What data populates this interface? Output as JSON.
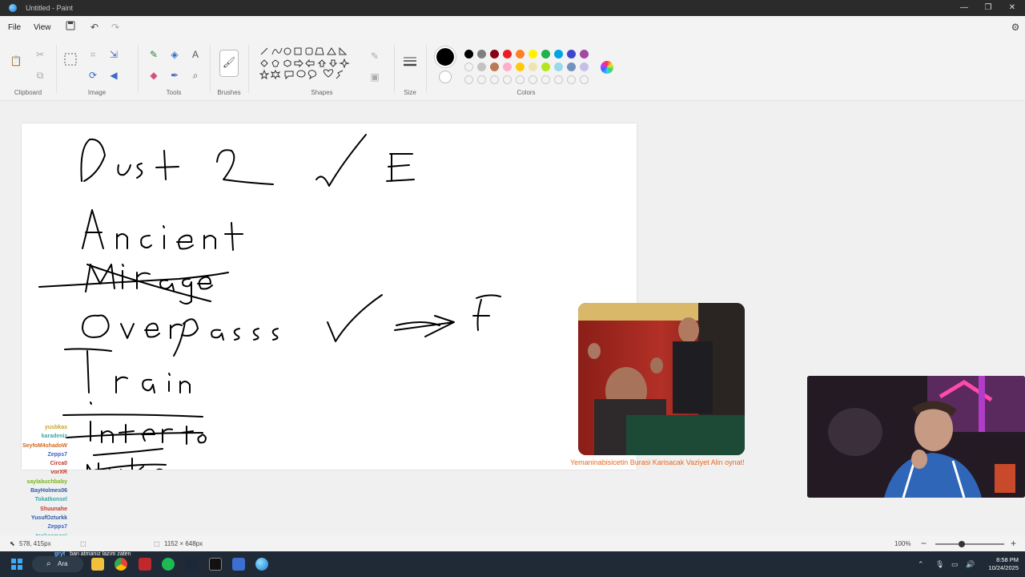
{
  "window": {
    "title": "Untitled - Paint",
    "minimize": "—",
    "maximize": "❐",
    "close": "✕"
  },
  "menu": {
    "file": "File",
    "view": "View",
    "save_icon": "save-icon",
    "undo_icon": "undo-icon",
    "redo_icon": "redo-icon"
  },
  "ribbon": {
    "clipboard": "Clipboard",
    "image": "Image",
    "tools": "Tools",
    "brushes": "Brushes",
    "shapes": "Shapes",
    "size": "Size",
    "colors": "Colors",
    "palette_row1": [
      "#000000",
      "#7f7f7f",
      "#880015",
      "#ed1c24",
      "#ff7f27",
      "#fff200",
      "#22b14c",
      "#00a2e8",
      "#3f48cc",
      "#a349a4"
    ],
    "palette_row2": [
      "",
      "#c3c3c3",
      "#b97a57",
      "#ffaec9",
      "#ffc90e",
      "#efe4b0",
      "#b5e61d",
      "#99d9ea",
      "#7092be",
      "#c8bfe7"
    ]
  },
  "overlay": {
    "caption": "Yemaninabisicetin Burasi Karisacak Vaziyet Alin oynat!"
  },
  "chat": [
    {
      "user": "yusbkas",
      "color": "#c9a227",
      "msg": ""
    },
    {
      "user": "karadeniz",
      "color": "#3aa6a6",
      "msg": ""
    },
    {
      "user": "SeyfoM4shadoW",
      "color": "#d2691e",
      "msg": ""
    },
    {
      "user": "Zepps7",
      "color": "#3b63c4",
      "msg": ""
    },
    {
      "user": "Circa0",
      "color": "#c0392b",
      "msg": ""
    },
    {
      "user": "vorXR",
      "color": "#c0392b",
      "msg": ""
    },
    {
      "user": "saylabuchbaby",
      "color": "#7cb518",
      "msg": ""
    },
    {
      "user": "BayHolmes06",
      "color": "#2d5aa8",
      "msg": ""
    },
    {
      "user": "Tokatkonsel",
      "color": "#3aa6a6",
      "msg": ""
    },
    {
      "user": "Shuunahe",
      "color": "#c0392b",
      "msg": ""
    },
    {
      "user": "YusufOzturkk",
      "color": "#2d5aa8",
      "msg": ""
    },
    {
      "user": "Zepps7",
      "color": "#3b63c4",
      "msg": ""
    },
    {
      "user": "tankenmoni",
      "color": "#3aa6a6",
      "msg": ""
    }
  ],
  "chat_last": {
    "user": "gryt",
    "msg": "ban atmanız lazım zaten"
  },
  "status": {
    "cursor_pos": "578, 415px",
    "canvas_size": "1152 × 648px",
    "zoom": "100%"
  },
  "taskbar": {
    "search": "Ara",
    "time": "8:58 PM",
    "date": "10/24/2025"
  }
}
